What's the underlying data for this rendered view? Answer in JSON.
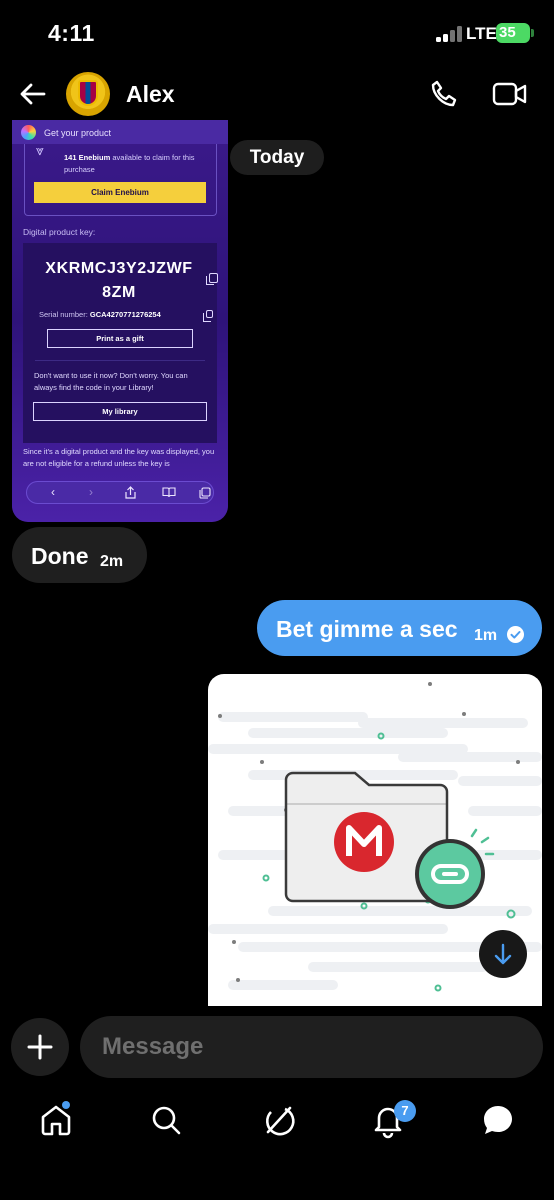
{
  "status_bar": {
    "time": "4:11",
    "network": "LTE",
    "battery": "35"
  },
  "header": {
    "contact_name": "Alex"
  },
  "shared_image": {
    "top_title": "Get your product",
    "enebium_amount": "141 Enebium",
    "enebium_text": "available to claim for this purchase",
    "claim_button": "Claim Enebium",
    "key_label": "Digital product key:",
    "key_line1": "XKRMCJ3Y2JZWF",
    "key_line2": "8ZM",
    "serial_label": "Serial number:",
    "serial_value": "GCA4270771276254",
    "print_button": "Print as a gift",
    "dont_text": "Don't want to use it now? Don't worry. You can always find the code in your Library!",
    "library_button": "My library",
    "since_text": "Since it's a digital product and the key was displayed, you are not eligible for a refund unless the key is"
  },
  "date_divider": "Today",
  "messages": [
    {
      "direction": "incoming",
      "text": "Done",
      "time": "2m"
    },
    {
      "direction": "outgoing",
      "text": "Bet gimme a sec",
      "time": "1m"
    }
  ],
  "composer": {
    "placeholder": "Message"
  },
  "tabbar": {
    "notifications_badge": "7"
  },
  "colors": {
    "accent": "#4a9cf0",
    "bubble_in": "#1f1f1f",
    "mega_red": "#d9272e",
    "link_green": "#5cc9a0"
  },
  "icons": [
    "back-arrow-icon",
    "phone-icon",
    "video-camera-icon",
    "plus-icon",
    "home-icon",
    "search-icon",
    "grok-icon",
    "bell-icon",
    "chat-icon",
    "arrow-down-icon",
    "mega-logo-icon",
    "link-icon",
    "checkmark-icon"
  ]
}
